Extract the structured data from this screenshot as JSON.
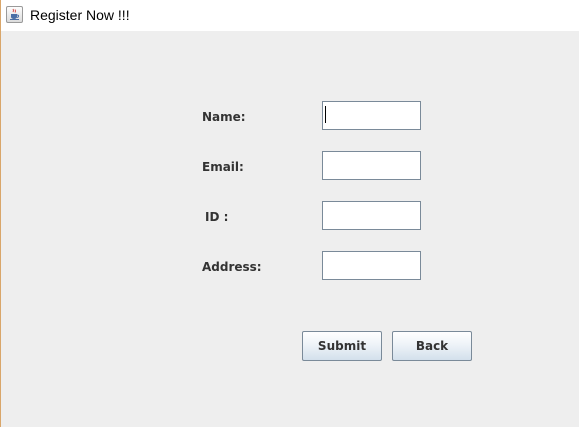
{
  "window": {
    "title": "Register Now !!!",
    "icon": "java-coffee-cup-icon"
  },
  "form": {
    "name_label": "Name:",
    "email_label": "Email:",
    "id_label": "ID :",
    "address_label": "Address:",
    "name_value": "",
    "email_value": "",
    "id_value": "",
    "address_value": ""
  },
  "buttons": {
    "submit_label": "Submit",
    "back_label": "Back"
  },
  "colors": {
    "background": "#eeeeee",
    "field_border": "#7a8a99",
    "label_text": "#333333"
  }
}
